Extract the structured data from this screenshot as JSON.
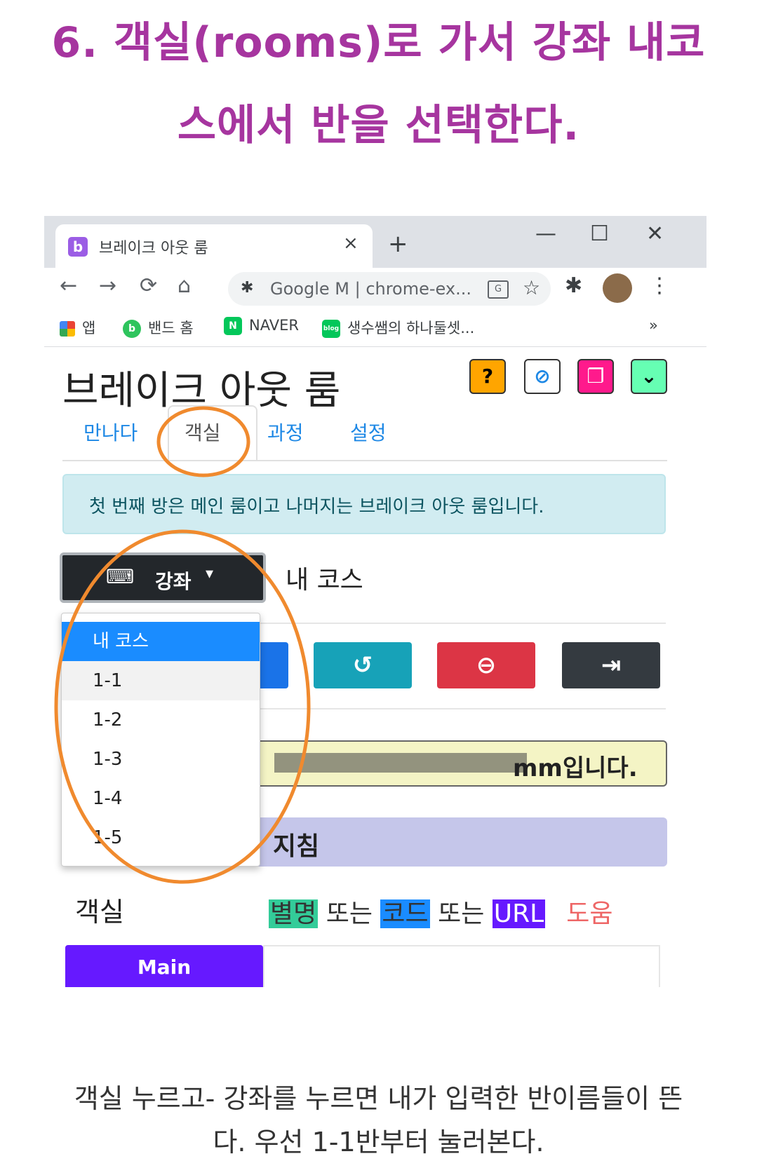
{
  "headline": {
    "line1": "6. 객실(rooms)로 가서 강좌 내코",
    "line2": "스에서 반을 선택한다."
  },
  "browser": {
    "tab_title": "브레이크 아웃 룸",
    "tab_favicon": "b",
    "tab_close": "×",
    "new_tab": "+",
    "win_min": "—",
    "win_max": "☐",
    "win_close": "✕",
    "address": "Google M  |  chrome-ex...",
    "bookmarks": [
      {
        "label": "앱",
        "icon": "apps-grid-icon"
      },
      {
        "label": "밴드 홈",
        "icon": "band-icon"
      },
      {
        "label": "NAVER",
        "icon": "naver-icon"
      },
      {
        "label": "생수쌤의 하나둘셋...",
        "icon": "blog-icon"
      }
    ],
    "more": "»"
  },
  "page": {
    "title": "브레이크 아웃 룸",
    "help": "?",
    "tabs": [
      "만나다",
      "객실",
      "과정",
      "설정"
    ],
    "info": "첫 번째 방은 메인 룸이고 나머지는 브레이크 아웃 룸입니다.",
    "course_button": "강좌",
    "course_selected": "내 코스",
    "dropdown": [
      "내 코스",
      "1-1",
      "1-2",
      "1-3",
      "1-4",
      "1-5"
    ],
    "yellow_text": "mm입니다.",
    "purple_text": "지침",
    "room_label": "객실",
    "alias": "별명",
    "or1": " 또는 ",
    "code": "코드",
    "or2": " 또는 ",
    "url": "URL",
    "help_link": "도움",
    "main_button": "Main"
  },
  "caption": {
    "line1": "객실 누르고- 강좌를 누르면 내가 입력한 반이름들이 뜬",
    "line2": "다. 우선 1-1반부터 눌러본다."
  },
  "colors": {
    "headline": "#a6359f",
    "annotation": "#f08a2e",
    "accent": "#6619ff"
  }
}
